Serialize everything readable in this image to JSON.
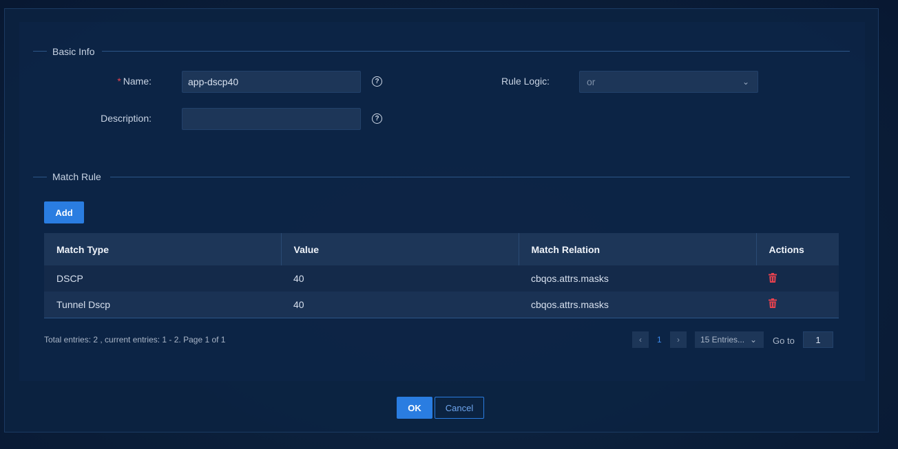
{
  "basic_info": {
    "title": "Basic Info",
    "name_label": "Name:",
    "name_value": "app-dscp40",
    "description_label": "Description:",
    "description_value": "",
    "rule_logic_label": "Rule Logic:",
    "rule_logic_value": "or"
  },
  "match_rule": {
    "title": "Match Rule",
    "add_label": "Add",
    "columns": [
      "Match Type",
      "Value",
      "Match Relation",
      "Actions"
    ],
    "rows": [
      {
        "match_type": "DSCP",
        "value": "40",
        "relation": "cbqos.attrs.masks"
      },
      {
        "match_type": "Tunnel Dscp",
        "value": "40",
        "relation": "cbqos.attrs.masks"
      }
    ]
  },
  "pagination": {
    "summary": "Total entries: 2 , current entries: 1 - 2. Page 1 of 1",
    "current_page": "1",
    "page_size": "15 Entries...",
    "goto_label": "Go to",
    "goto_value": "1"
  },
  "footer": {
    "ok_label": "OK",
    "cancel_label": "Cancel"
  },
  "colors": {
    "accent": "#2a7de1",
    "danger": "#e6424f"
  }
}
